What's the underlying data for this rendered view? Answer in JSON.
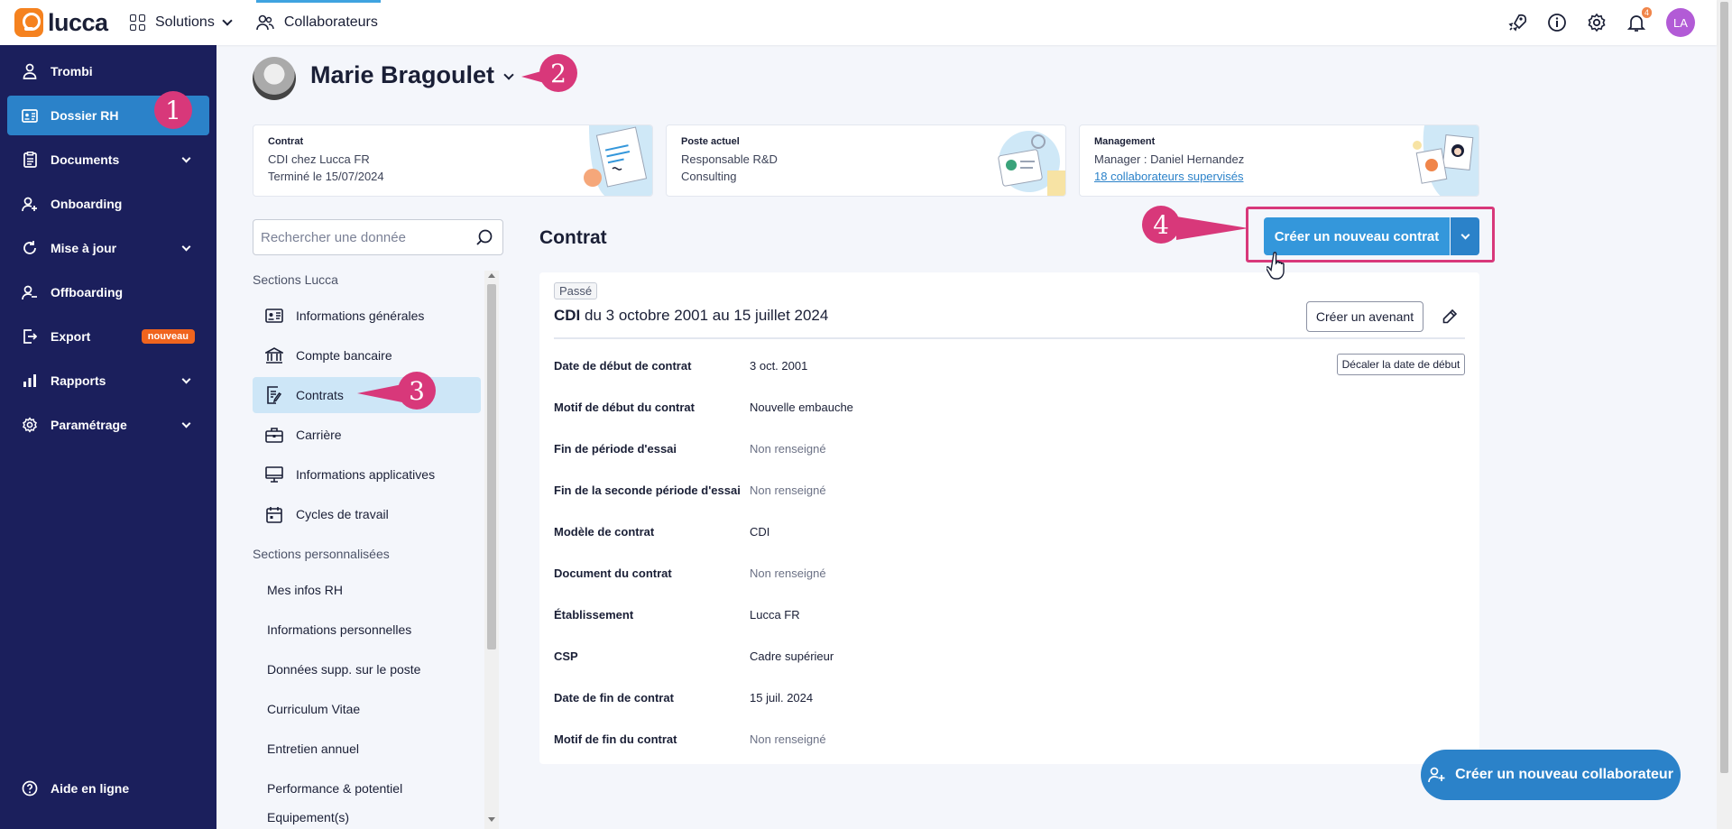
{
  "topbar": {
    "logo_text": "lucca",
    "solutions_label": "Solutions",
    "collaborateurs_label": "Collaborateurs",
    "notification_count": "4",
    "user_initials": "LA",
    "colors": {
      "accent": "#3fa3e0",
      "logo": "#f5821f",
      "avatar": "#b25bd6"
    }
  },
  "sidebar": {
    "items": [
      {
        "label": "Trombi",
        "icon": "user-icon"
      },
      {
        "label": "Dossier RH",
        "icon": "id-card-icon",
        "active": true
      },
      {
        "label": "Documents",
        "icon": "clipboard-icon",
        "dropdown": true
      },
      {
        "label": "Onboarding",
        "icon": "user-plus-icon"
      },
      {
        "label": "Mise à jour",
        "icon": "refresh-icon",
        "dropdown": true
      },
      {
        "label": "Offboarding",
        "icon": "user-minus-icon"
      },
      {
        "label": "Export",
        "icon": "export-icon",
        "badge": "nouveau"
      },
      {
        "label": "Rapports",
        "icon": "bar-chart-icon",
        "dropdown": true
      },
      {
        "label": "Paramétrage",
        "icon": "gear-icon",
        "dropdown": true
      }
    ],
    "help_label": "Aide en ligne",
    "colors": {
      "background": "#1b1f5c",
      "active": "#2b82c9"
    }
  },
  "callouts": [
    "1",
    "2",
    "3",
    "4"
  ],
  "profile": {
    "name": "Marie Bragoulet"
  },
  "cards": {
    "contrat": {
      "label": "Contrat",
      "line1": "CDI chez Lucca FR",
      "line2": "Terminé le 15/07/2024"
    },
    "poste": {
      "label": "Poste actuel",
      "line1": "Responsable R&D",
      "line2": "Consulting"
    },
    "management": {
      "label": "Management",
      "line1": "Manager : Daniel Hernandez",
      "link": "18 collaborateurs supervisés"
    }
  },
  "sections": {
    "search_placeholder": "Rechercher une donnée",
    "lucca_title": "Sections Lucca",
    "lucca_items": [
      {
        "label": "Informations générales",
        "icon": "id-card-icon"
      },
      {
        "label": "Compte bancaire",
        "icon": "bank-icon"
      },
      {
        "label": "Contrats",
        "icon": "contract-icon",
        "active": true
      },
      {
        "label": "Carrière",
        "icon": "briefcase-icon"
      },
      {
        "label": "Informations applicatives",
        "icon": "monitor-icon"
      },
      {
        "label": "Cycles de travail",
        "icon": "calendar-icon"
      }
    ],
    "custom_title": "Sections personnalisées",
    "custom_items": [
      "Mes infos RH",
      "Informations personnelles",
      "Données supp. sur le poste",
      "Curriculum Vitae",
      "Entretien annuel",
      "Performance & potentiel",
      "Equipement(s)"
    ]
  },
  "main": {
    "title": "Contrat",
    "create_button": "Créer un nouveau contrat",
    "status_tag": "Passé",
    "contract_type": "CDI",
    "contract_period": " du 3 octobre 2001 au 15 juillet 2024",
    "avenant_button": "Créer un avenant",
    "decaler_button": "Décaler la date de début",
    "fields": [
      {
        "key": "Date de début de contrat",
        "value": "3 oct. 2001",
        "muted": false
      },
      {
        "key": "Motif de début du contrat",
        "value": "Nouvelle embauche",
        "muted": false
      },
      {
        "key": "Fin de période d'essai",
        "value": "Non renseigné",
        "muted": true
      },
      {
        "key": "Fin de la seconde période d'essai",
        "value": "Non renseigné",
        "muted": true
      },
      {
        "key": "Modèle de contrat",
        "value": "CDI",
        "muted": false
      },
      {
        "key": "Document du contrat",
        "value": "Non renseigné",
        "muted": true
      },
      {
        "key": "Établissement",
        "value": "Lucca FR",
        "muted": false
      },
      {
        "key": "CSP",
        "value": "Cadre supérieur",
        "muted": false
      },
      {
        "key": "Date de fin de contrat",
        "value": "15 juil. 2024",
        "muted": false
      },
      {
        "key": "Motif de fin du contrat",
        "value": "Non renseigné",
        "muted": true
      }
    ]
  },
  "fab": {
    "label": "Créer un nouveau collaborateur"
  },
  "colors": {
    "callout": "#d8387a",
    "primary_button": "#3497db"
  }
}
